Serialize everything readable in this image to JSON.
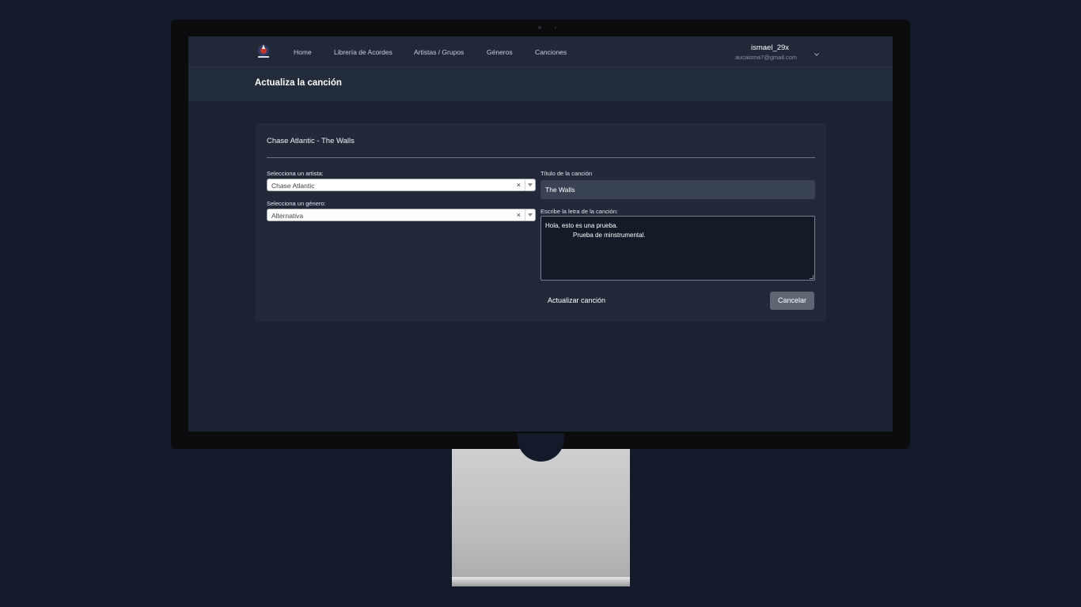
{
  "navbar": {
    "items": [
      "Home",
      "Librería de Acordes",
      "Artistas / Grupos",
      "Géneros",
      "Canciones"
    ],
    "user_name": "ismael_29x",
    "user_email": "aucaisma7@gmail.com"
  },
  "header": {
    "title": "Actualiza la canción"
  },
  "form": {
    "card_title": "Chase Atlantic - The Walls",
    "artist_label": "Selecciona un artista:",
    "artist_value": "Chase Atlantic",
    "genre_label": "Selecciona un género:",
    "genre_value": "Alternativa",
    "clear_glyph": "×",
    "song_title_label": "Título de la canción",
    "song_title_value": "The Walls",
    "lyrics_label": "Escribe la letra de la canción:",
    "lyrics_line1": "Hola, esto es una prueba.",
    "lyrics_line2": "Prueba de minstrumental.",
    "update_label": "Actualizar canción",
    "cancel_label": "Cancelar"
  },
  "colors": {
    "page_bg": "#131a2a",
    "screen_bg": "#1b2231",
    "card_bg": "#222a3a",
    "cancel_button": "#5f6775"
  },
  "icons": [
    "app-logo-icon",
    "chevron-down-icon",
    "clear-icon",
    "dropdown-arrow-icon",
    "resize-handle-icon"
  ]
}
